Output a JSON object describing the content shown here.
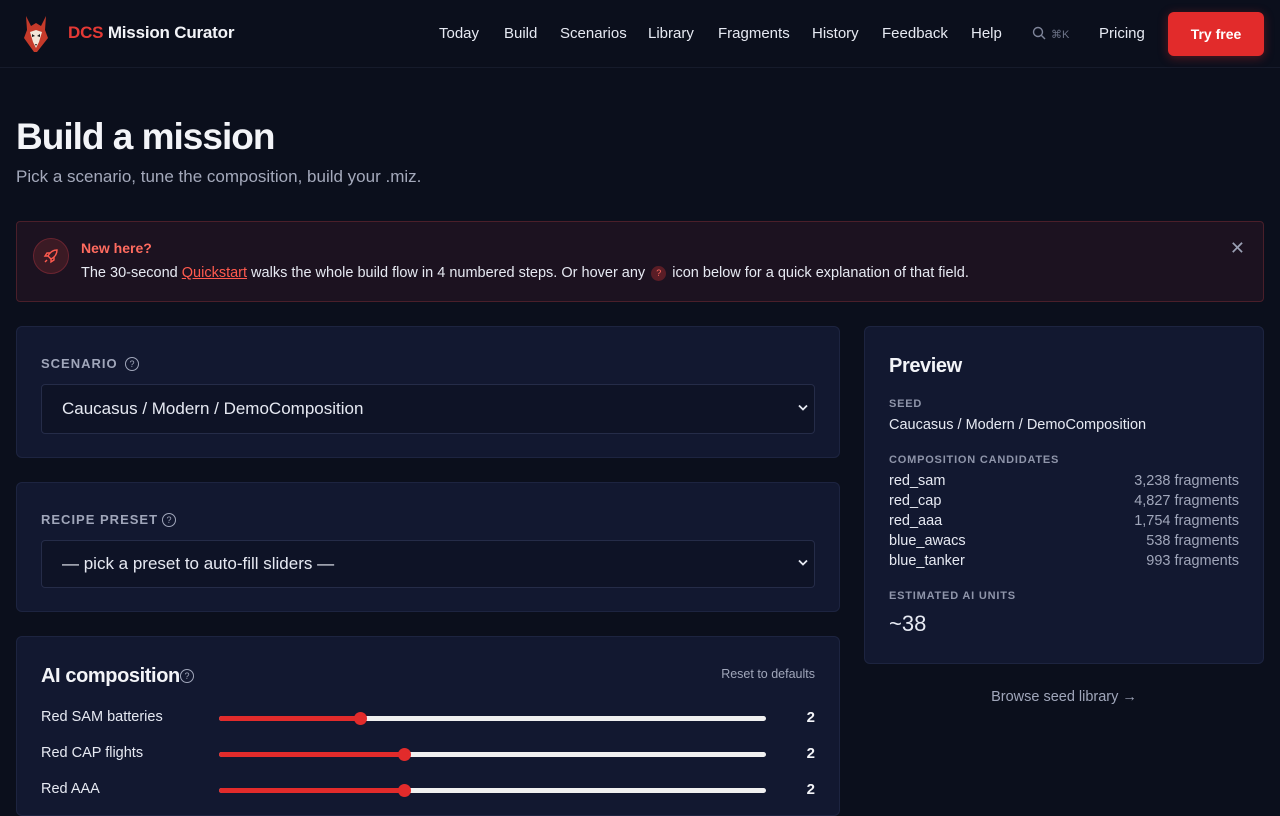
{
  "brand": {
    "prefix": "DCS",
    "name": "Mission Curator"
  },
  "nav": [
    "Today",
    "Build",
    "Scenarios",
    "Library",
    "Fragments",
    "History",
    "Feedback",
    "Help"
  ],
  "search": {
    "shortcut": "⌘K"
  },
  "header": {
    "pricing": "Pricing",
    "cta": "Try free"
  },
  "page": {
    "title": "Build a mission",
    "subtitle": "Pick a scenario, tune the composition, build your .miz."
  },
  "banner": {
    "title": "New here?",
    "text_before": "The 30-second ",
    "link": "Quickstart",
    "text_middle": " walks the whole build flow in 4 numbered steps. Or hover any ",
    "text_after": " icon below for a quick explanation of that field.",
    "qmark": "?",
    "close": "✕"
  },
  "scenario": {
    "label": "SCENARIO",
    "selected": "Caucasus / Modern / DemoComposition"
  },
  "recipe": {
    "label": "RECIPE PRESET",
    "selected": "— pick a preset to auto-fill sliders —"
  },
  "ai": {
    "title": "AI composition",
    "reset": "Reset to defaults",
    "sliders": [
      {
        "label": "Red SAM batteries",
        "value": "2",
        "fraction": 0.257
      },
      {
        "label": "Red CAP flights",
        "value": "2",
        "fraction": 0.338
      },
      {
        "label": "Red AAA",
        "value": "2",
        "fraction": 0.338
      }
    ]
  },
  "preview": {
    "title": "Preview",
    "seed_label": "SEED",
    "seed_value": "Caucasus / Modern / DemoComposition",
    "candidates_label": "COMPOSITION CANDIDATES",
    "candidates": [
      {
        "name": "red_sam",
        "count": "3,238 fragments"
      },
      {
        "name": "red_cap",
        "count": "4,827 fragments"
      },
      {
        "name": "red_aaa",
        "count": "1,754 fragments"
      },
      {
        "name": "blue_awacs",
        "count": "538 fragments"
      },
      {
        "name": "blue_tanker",
        "count": "993 fragments"
      }
    ],
    "est_label": "ESTIMATED AI UNITS",
    "est_value": "~38"
  },
  "browse": "Browse seed library →"
}
